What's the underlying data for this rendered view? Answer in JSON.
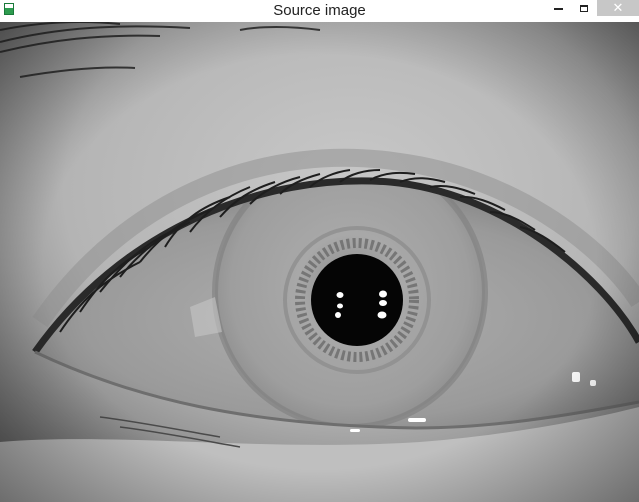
{
  "window": {
    "title": "Source image"
  },
  "controls": {
    "minimize_icon": "minimize-icon",
    "maximize_icon": "maximize-icon",
    "close_icon": "close-icon",
    "close_glyph": "✕"
  },
  "image": {
    "description_icon": "eye-photo",
    "colors": {
      "skin": "#bdbdbd",
      "sclera": "#a5a5a5",
      "iris": "#9c9c9c",
      "pupil": "#050505"
    }
  }
}
